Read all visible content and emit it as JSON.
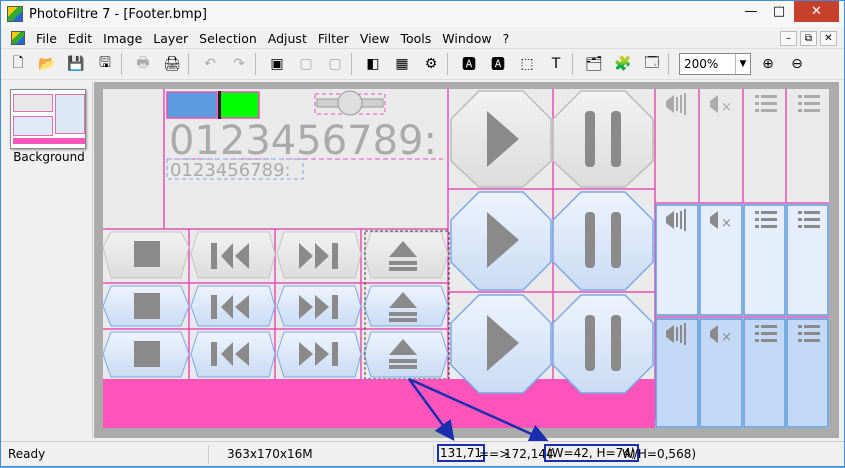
{
  "window": {
    "title": "PhotoFiltre 7 - [Footer.bmp]",
    "min_glyph": "—",
    "max_glyph": "□",
    "close_glyph": "✕"
  },
  "menu": [
    "File",
    "Edit",
    "Image",
    "Layer",
    "Selection",
    "Adjust",
    "Filter",
    "View",
    "Tools",
    "Window",
    "?"
  ],
  "mdi_controls": [
    "–",
    "⧉",
    "✕"
  ],
  "toolbar": {
    "icons": [
      "new-icon",
      "open-icon",
      "save-icon",
      "save-as-icon",
      "print-icon",
      "scan-icon",
      "undo-icon",
      "redo-icon",
      "image-icon",
      "image2-icon",
      "image3-icon",
      "grayscale-icon",
      "color-icon",
      "automate-icon",
      "text-mask-icon",
      "text-mask2-icon",
      "selection-icon",
      "text-icon",
      "explorer-icon",
      "plugins-icon",
      "window-icon",
      "zoom-in-icon",
      "zoom-out-icon"
    ],
    "glyphs": [
      "🗋",
      "📂",
      "💾",
      "🖫",
      "🖶",
      "🖨",
      "↶",
      "↷",
      "▣",
      "▢",
      "▢",
      "◧",
      "▦",
      "⚙",
      "🅰",
      "🅰",
      "⬚",
      "T",
      "🗂",
      "🧩",
      "🗔",
      "⊕",
      "⊖"
    ],
    "zoom_value": "200%",
    "zoom_arrow": "▼"
  },
  "navigator": {
    "layer_label": "Background"
  },
  "canvas_content": {
    "digits_large": "0123456789: -",
    "digits_small": "0123456789:"
  },
  "status": {
    "ready": "Ready",
    "image_info": "363x170x16M",
    "cursor_pos": "131,71",
    "arrow": "==>",
    "end_pos": "172,144",
    "size_dims": "(W=42, H=74)",
    "ratio": "W/H=0,568)"
  },
  "colors": {
    "accent_pink": "#ff55bb",
    "guide_pink": "#e651b6",
    "button_blue": "#dbe8f9",
    "button_blue_dark": "#c3d9f5",
    "annotation_blue": "#1a2fb0",
    "green": "#00ff00"
  }
}
